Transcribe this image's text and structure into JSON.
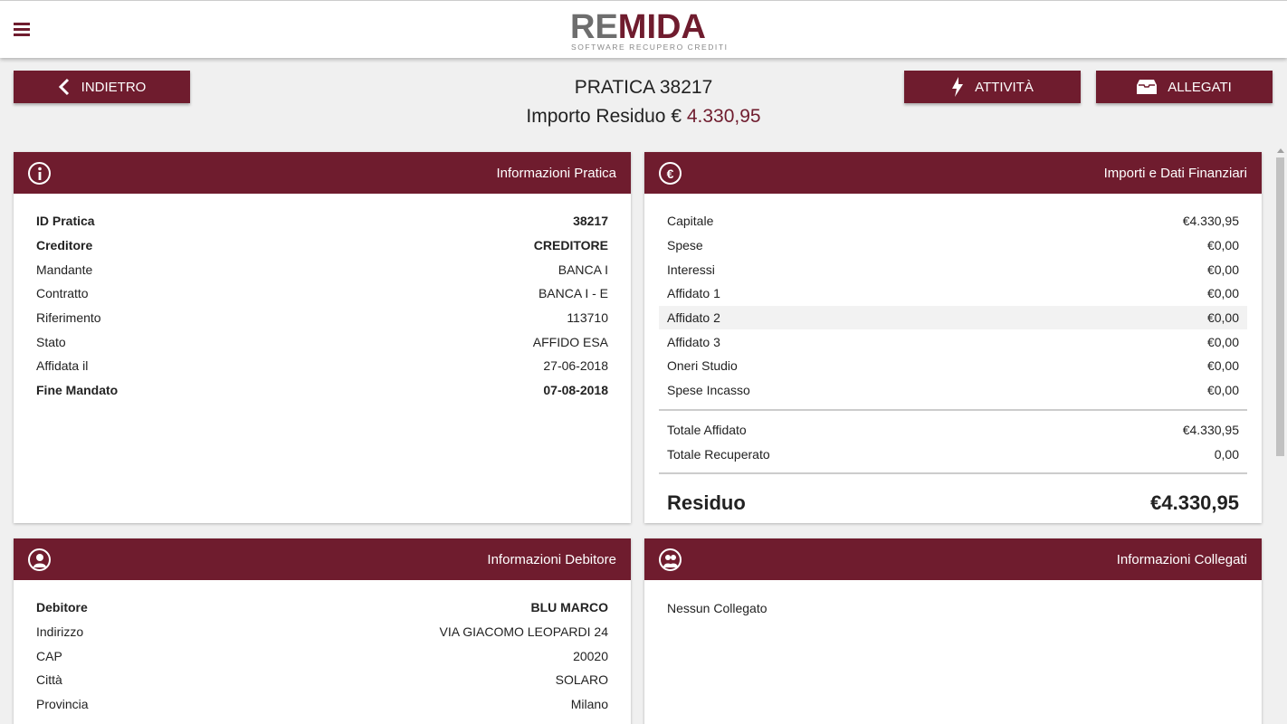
{
  "header": {
    "logo_re": "RE",
    "logo_mida": "MIDA",
    "logo_sub": "SOFTWARE RECUPERO CREDITI"
  },
  "buttons": {
    "back": "INDIETRO",
    "activity": "ATTIVITÀ",
    "attachments": "ALLEGATI"
  },
  "title": "PRATICA 38217",
  "subtitle_label": "Importo Residuo € ",
  "subtitle_amount": "4.330,95",
  "practice": {
    "title": "Informazioni Pratica",
    "rows": [
      {
        "label": "ID Pratica",
        "value": "38217"
      },
      {
        "label": "Creditore",
        "value": "CREDITORE"
      },
      {
        "label": "Mandante",
        "value": "BANCA I"
      },
      {
        "label": "Contratto",
        "value": "BANCA I - E"
      },
      {
        "label": "Riferimento",
        "value": "113710"
      },
      {
        "label": "Stato",
        "value": "AFFIDO ESA"
      },
      {
        "label": "Affidata il",
        "value": "27-06-2018"
      },
      {
        "label": "Fine Mandato",
        "value": "07-08-2018"
      }
    ]
  },
  "finance": {
    "title": "Importi e Dati Finanziari",
    "rows": [
      {
        "label": "Capitale",
        "value": "€4.330,95"
      },
      {
        "label": "Spese",
        "value": "€0,00"
      },
      {
        "label": "Interessi",
        "value": "€0,00"
      },
      {
        "label": "Affidato 1",
        "value": "€0,00"
      },
      {
        "label": "Affidato 2",
        "value": "€0,00"
      },
      {
        "label": "Affidato 3",
        "value": "€0,00"
      },
      {
        "label": "Oneri Studio",
        "value": "€0,00"
      },
      {
        "label": "Spese Incasso",
        "value": "€0,00"
      }
    ],
    "totals": [
      {
        "label": "Totale Affidato",
        "value": "€4.330,95"
      },
      {
        "label": "Totale Recuperato",
        "value": "0,00"
      }
    ],
    "residuo_label": "Residuo",
    "residuo_value": "€4.330,95"
  },
  "debtor": {
    "title": "Informazioni Debitore",
    "rows": [
      {
        "label": "Debitore",
        "value": "BLU MARCO"
      },
      {
        "label": "Indirizzo",
        "value": "VIA GIACOMO LEOPARDI 24"
      },
      {
        "label": "CAP",
        "value": "20020"
      },
      {
        "label": "Città",
        "value": "SOLARO"
      },
      {
        "label": "Provincia",
        "value": "Milano"
      }
    ]
  },
  "linked": {
    "title": "Informazioni Collegati",
    "empty": "Nessun Collegato"
  },
  "colors": {
    "brand": "#6f1c2e",
    "background": "#f0f0f0"
  }
}
